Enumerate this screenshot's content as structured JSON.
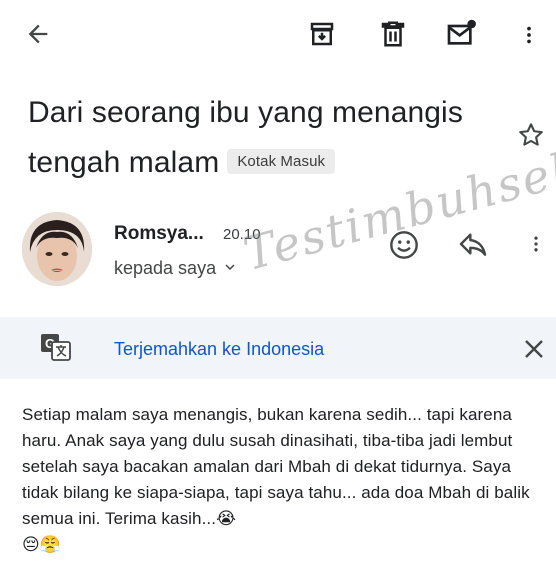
{
  "toolbar": {
    "back_icon": "arrow-left-icon",
    "archive_icon": "archive-icon",
    "delete_icon": "trash-icon",
    "mark_unread_icon": "mail-unread-icon",
    "more_icon": "more-vert-icon"
  },
  "email": {
    "subject": "Dari seorang ibu yang menangis tengah malam",
    "label": "Kotak Masuk",
    "sender": "Romsya...",
    "time": "20.10",
    "recipient": "kepada saya",
    "watermark": "Testimbuhselim",
    "body": "Setiap malam saya menangis, bukan karena sedih... tapi karena haru. Anak saya yang dulu susah dinasihati, tiba-tiba jadi lembut setelah saya bacakan amalan dari Mbah di dekat tidurnya. Saya tidak bilang ke siapa-siapa, tapi saya tahu... ada doa Mbah di balik semua ini. Terima kasih...😭",
    "body_emoji": "😔😤"
  },
  "translate": {
    "link": "Terjemahkan ke Indonesia"
  },
  "colors": {
    "link": "#0b57d0",
    "translate_bg": "#f1f4f9",
    "chip_bg": "#ececec"
  }
}
